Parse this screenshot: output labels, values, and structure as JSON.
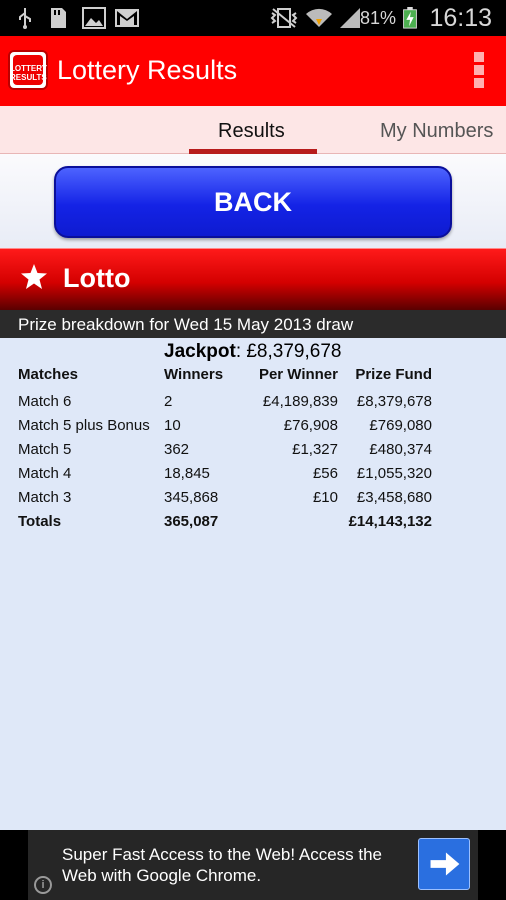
{
  "status_bar": {
    "time": "16:13",
    "battery": "81%",
    "icons": [
      "usb-icon",
      "sd-card-icon",
      "image-icon",
      "gmail-icon",
      "vibrate-icon",
      "wifi-icon",
      "signal-icon",
      "battery-charging-icon"
    ]
  },
  "app_bar": {
    "title": "Lottery Results",
    "logo_text": "LOTTERY RESULTS"
  },
  "tabs": [
    {
      "label": "Results",
      "selected": true
    },
    {
      "label": "My Numbers",
      "selected": false
    }
  ],
  "back_button": {
    "label": "BACK"
  },
  "game": {
    "title": "Lotto"
  },
  "draw": {
    "label": "Prize breakdown for Wed 15 May 2013 draw"
  },
  "jackpot": {
    "label": "Jackpot",
    "value": ": £8,379,678"
  },
  "table": {
    "headers": [
      "Matches",
      "Winners",
      "Per Winner",
      "Prize Fund"
    ],
    "rows": [
      {
        "matches": "Match 6",
        "winners": "2",
        "per_winner": "£4,189,839",
        "prize_fund": "£8,379,678"
      },
      {
        "matches": "Match 5 plus Bonus",
        "winners": "10",
        "per_winner": "£76,908",
        "prize_fund": "£769,080"
      },
      {
        "matches": "Match 5",
        "winners": "362",
        "per_winner": "£1,327",
        "prize_fund": "£480,374"
      },
      {
        "matches": "Match 4",
        "winners": "18,845",
        "per_winner": "£56",
        "prize_fund": "£1,055,320"
      },
      {
        "matches": "Match 3",
        "winners": "345,868",
        "per_winner": "£10",
        "prize_fund": "£3,458,680"
      }
    ],
    "totals": {
      "label": "Totals",
      "winners": "365,087",
      "per_winner": "",
      "prize_fund": "£14,143,132"
    }
  },
  "ad": {
    "text": "Super Fast Access to the Web! Access the Web with Google Chrome."
  },
  "colors": {
    "app_bar": "#ff0000",
    "back_button": "#1423e6",
    "content_bg": "#dfe8f8",
    "tab_indicator": "#b71c1c"
  }
}
